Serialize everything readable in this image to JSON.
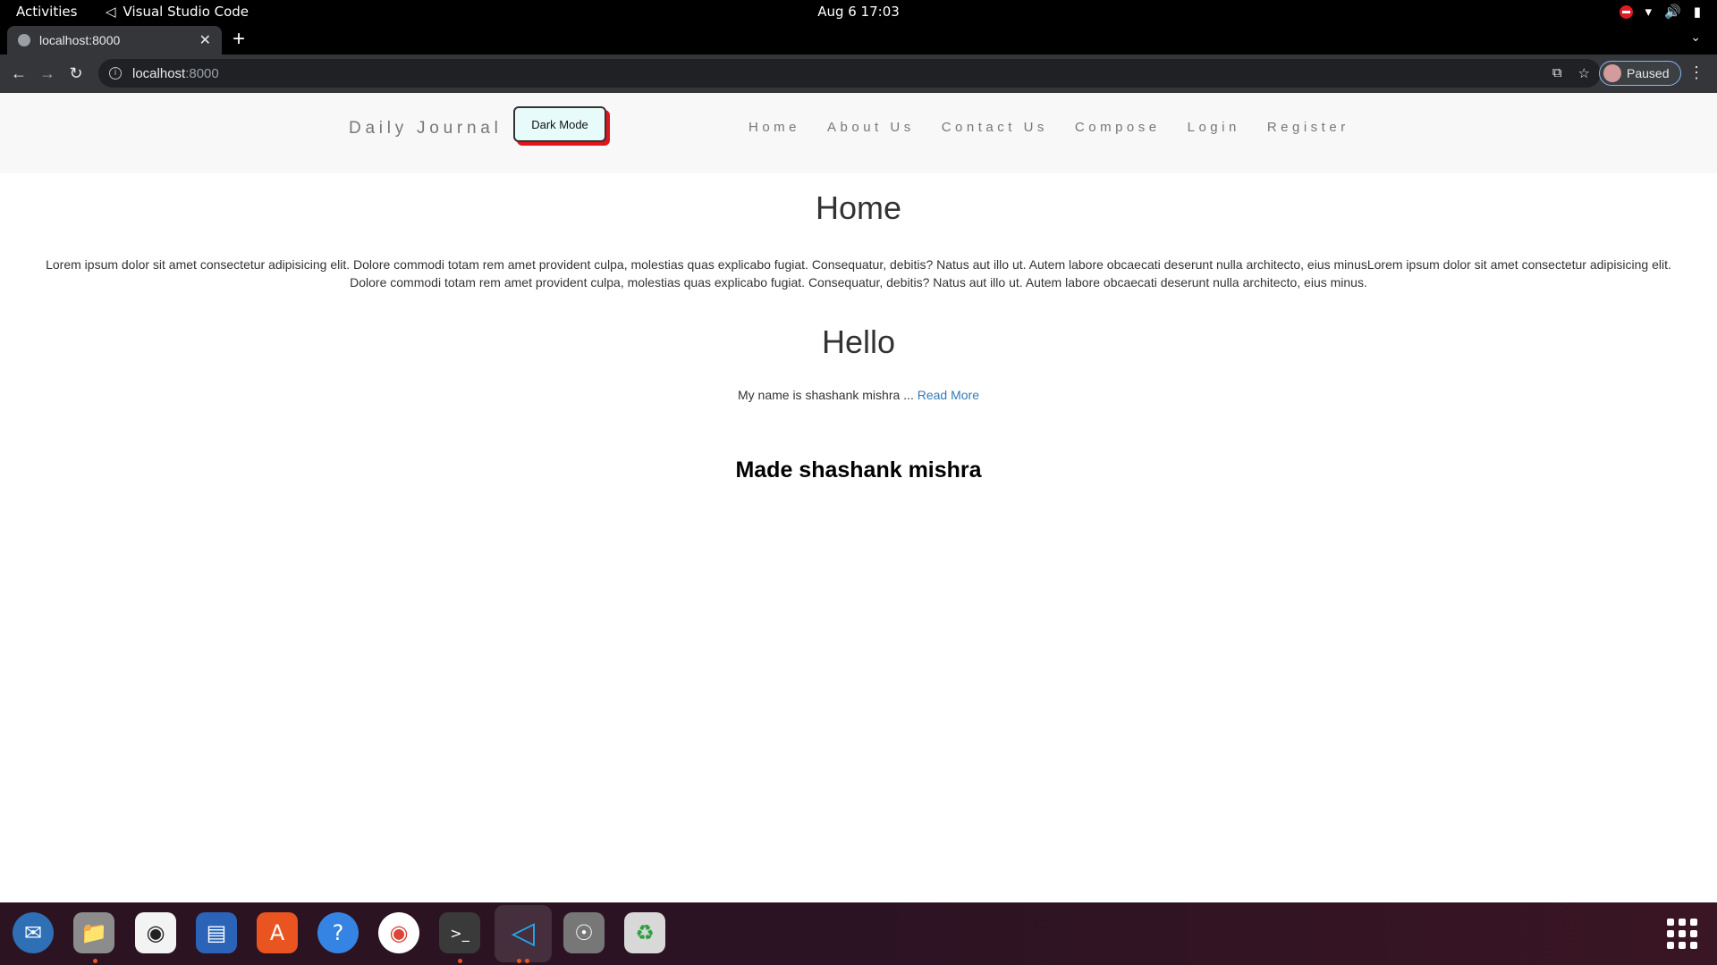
{
  "topbar": {
    "activities": "Activities",
    "app_name": "Visual Studio Code",
    "clock": "Aug 6  17:03"
  },
  "browser": {
    "tab_title": "localhost:8000",
    "url_host": "localhost",
    "url_port": ":8000",
    "profile_label": "Paused"
  },
  "site": {
    "brand": "Daily Journal",
    "dark_mode_button": "Dark Mode",
    "nav": {
      "home": "Home",
      "about": "About Us",
      "contact": "Contact Us",
      "compose": "Compose",
      "login": "Login",
      "register": "Register"
    },
    "home_title": "Home",
    "home_body": "Lorem ipsum dolor sit amet consectetur adipisicing elit. Dolore commodi totam rem amet provident culpa, molestias quas explicabo fugiat. Consequatur, debitis? Natus aut illo ut. Autem labore obcaecati deserunt nulla architecto, eius minusLorem ipsum dolor sit amet consectetur adipisicing elit. Dolore commodi totam rem amet provident culpa, molestias quas explicabo fugiat. Consequatur, debitis? Natus aut illo ut. Autem labore obcaecati deserunt nulla architecto, eius minus.",
    "post_title": "Hello",
    "post_excerpt": "My name is shashank mishra ...",
    "read_more": "Read More",
    "footer": "Made shashank mishra"
  },
  "colors": {
    "dark_button_shadow": "#e0141e",
    "link": "#337ab7",
    "navbar_bg": "#f8f8f8"
  }
}
